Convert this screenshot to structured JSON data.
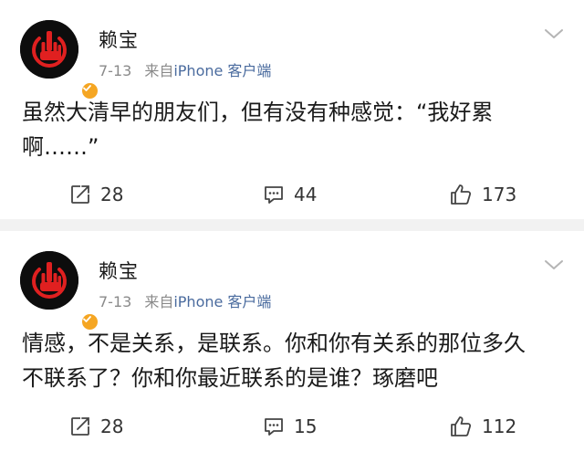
{
  "posts": [
    {
      "author": "赖宝",
      "date": "7-13",
      "source_prefix": "来自",
      "source": "iPhone 客户端",
      "text": "虽然大清早的朋友们，但有没有种感觉：“我好累啊……”",
      "reposts": "28",
      "comments": "44",
      "likes": "173"
    },
    {
      "author": "赖宝",
      "date": "7-13",
      "source_prefix": "来自",
      "source": "iPhone 客户端",
      "text": "情感，不是关系，是联系。你和你有关系的那位多久不联系了？你和你最近联系的是谁？琢磨吧",
      "reposts": "28",
      "comments": "15",
      "likes": "112"
    }
  ],
  "icons": {
    "avatar": "power-hand-icon",
    "verified": "verified-badge-icon",
    "menu": "chevron-down-icon",
    "repost": "repost-icon",
    "comment": "comment-icon",
    "like": "like-icon"
  },
  "colors": {
    "avatar_bg": "#0d0d0d",
    "avatar_accent": "#e02020",
    "verified": "#f5a623",
    "source_link": "#4a6b9e",
    "meta": "#8a8a8a",
    "separator": "#f2f2f2"
  }
}
